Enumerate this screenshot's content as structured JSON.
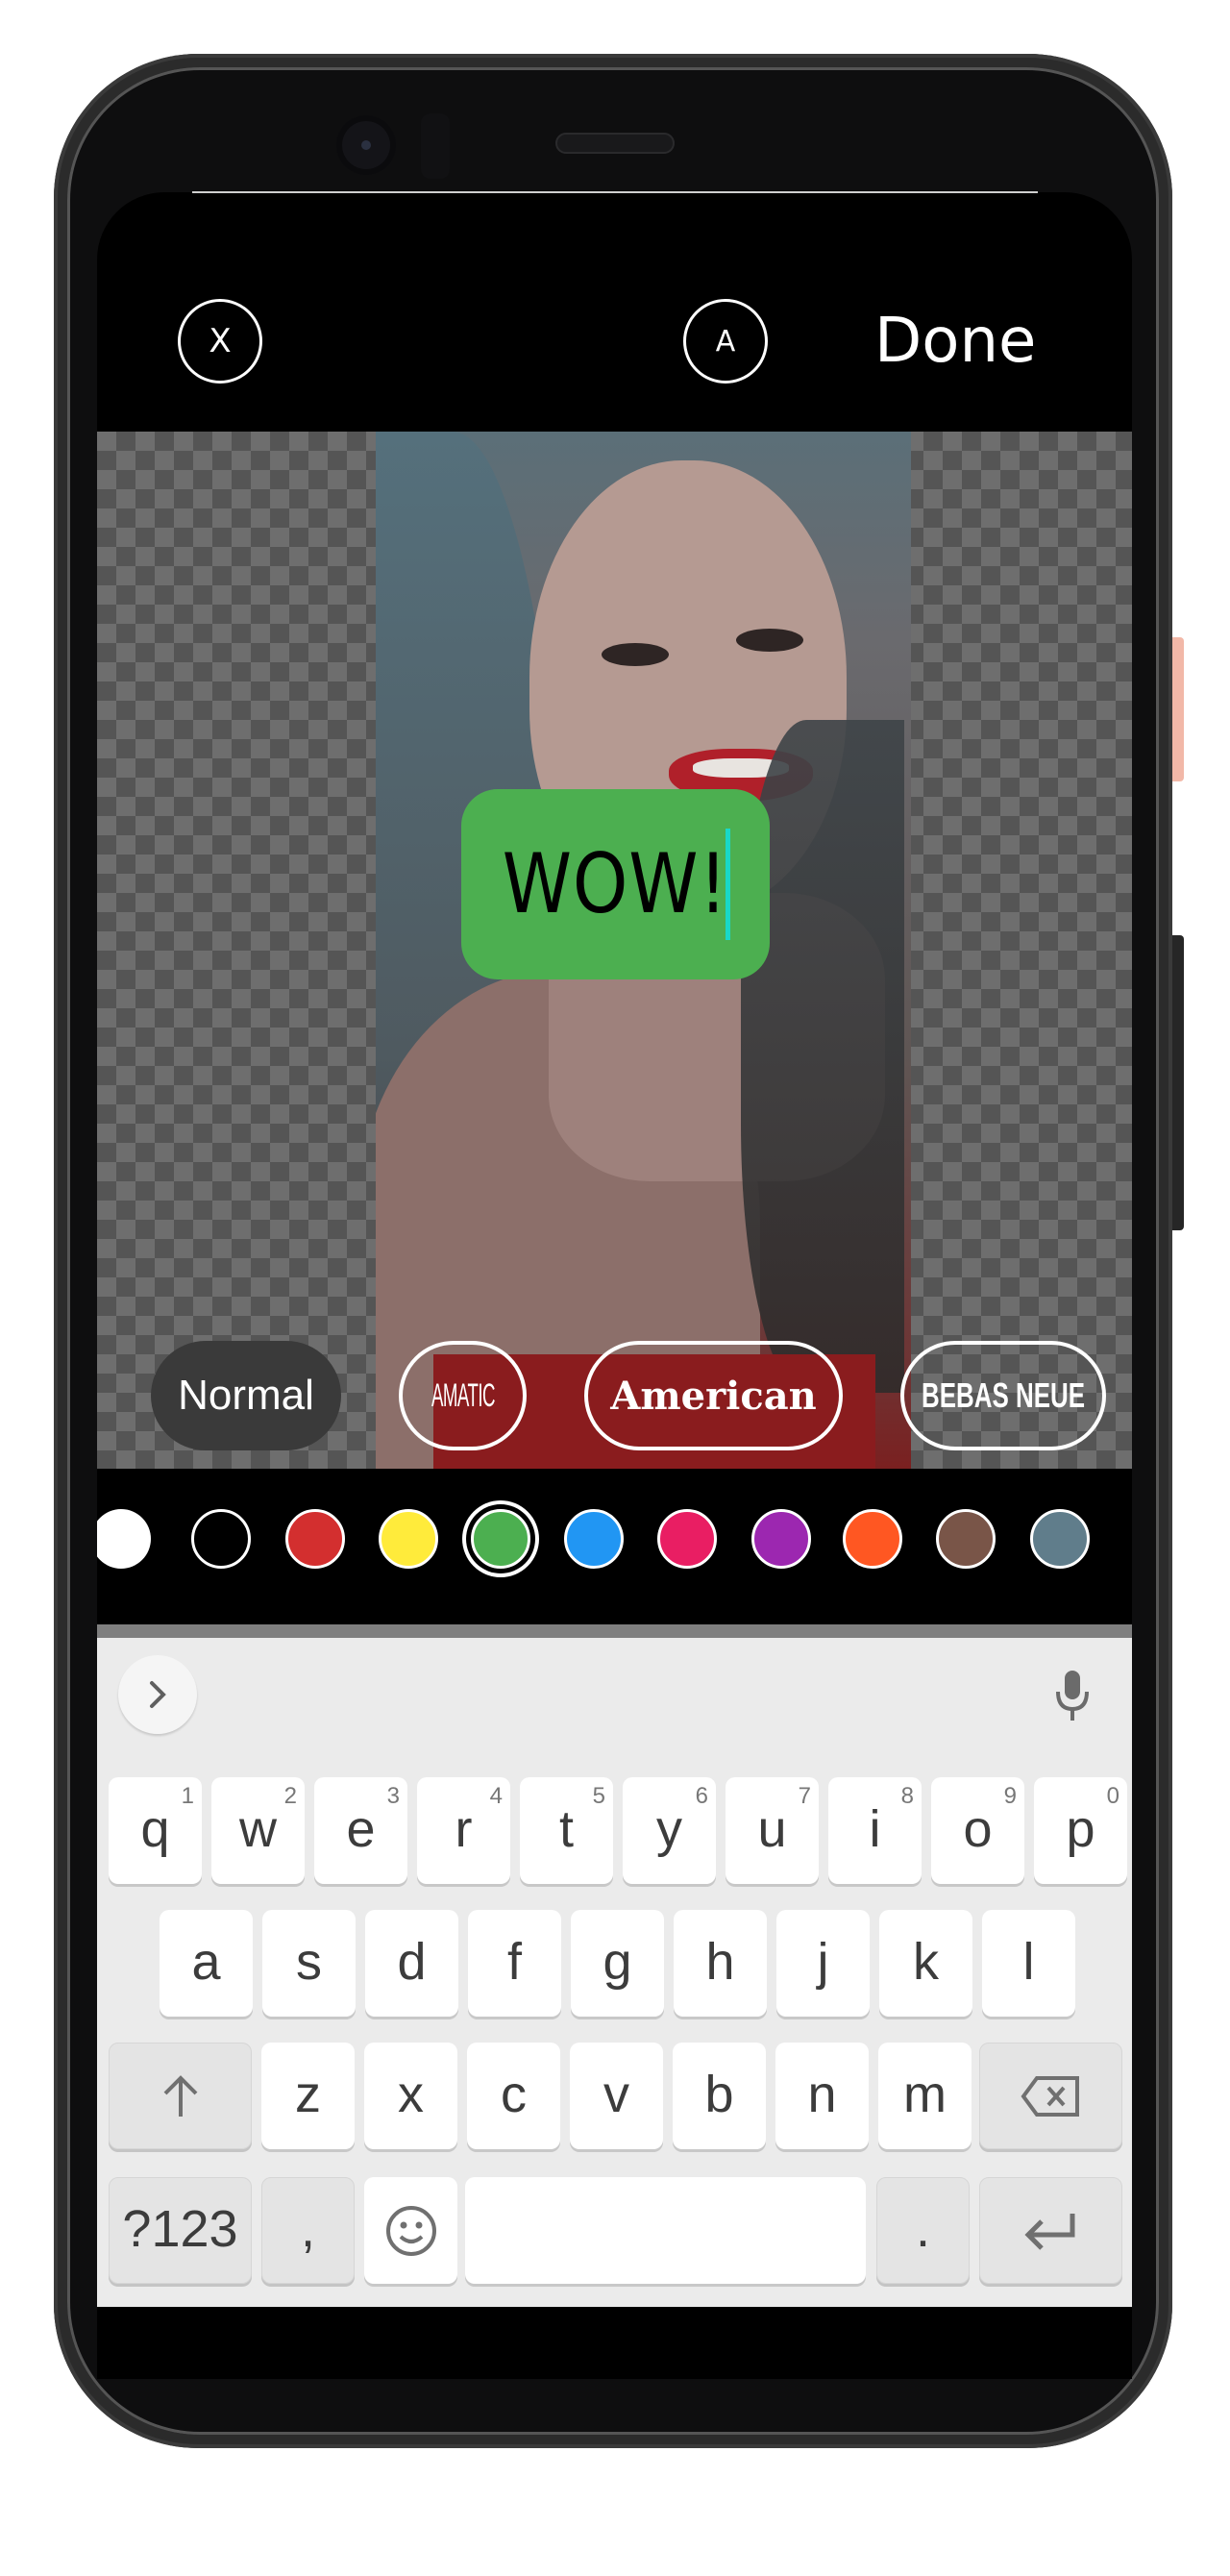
{
  "toolbar": {
    "close_label": "X",
    "font_toggle_label": "A",
    "done_label": "Done"
  },
  "editor": {
    "text_value": "WOW!",
    "bubble_color": "#4caf50",
    "caret_color": "#19d8c8"
  },
  "fonts": [
    {
      "label": "Normal",
      "selected": true
    },
    {
      "label": "AMATIC",
      "selected": false
    },
    {
      "label": "American",
      "selected": false
    },
    {
      "label": "BEBAS NEUE",
      "selected": false
    }
  ],
  "colors": {
    "selected": "#4caf50",
    "swatches": [
      "#ffffff",
      "#000000",
      "#d32f2f",
      "#ffeb3b",
      "#4caf50",
      "#2196f3",
      "#e91e63",
      "#9c27b0",
      "#ff5722",
      "#795548",
      "#607d8b"
    ]
  },
  "keyboard": {
    "row1": [
      {
        "key": "q",
        "hint": "1"
      },
      {
        "key": "w",
        "hint": "2"
      },
      {
        "key": "e",
        "hint": "3"
      },
      {
        "key": "r",
        "hint": "4"
      },
      {
        "key": "t",
        "hint": "5"
      },
      {
        "key": "y",
        "hint": "6"
      },
      {
        "key": "u",
        "hint": "7"
      },
      {
        "key": "i",
        "hint": "8"
      },
      {
        "key": "o",
        "hint": "9"
      },
      {
        "key": "p",
        "hint": "0"
      }
    ],
    "row2": [
      "a",
      "s",
      "d",
      "f",
      "g",
      "h",
      "j",
      "k",
      "l"
    ],
    "row3": [
      "z",
      "x",
      "c",
      "v",
      "b",
      "n",
      "m"
    ],
    "symbols_label": "?123",
    "comma_label": ",",
    "period_label": ".",
    "shift_icon": "↑",
    "enter_icon": "↵",
    "expand_icon": "›"
  }
}
